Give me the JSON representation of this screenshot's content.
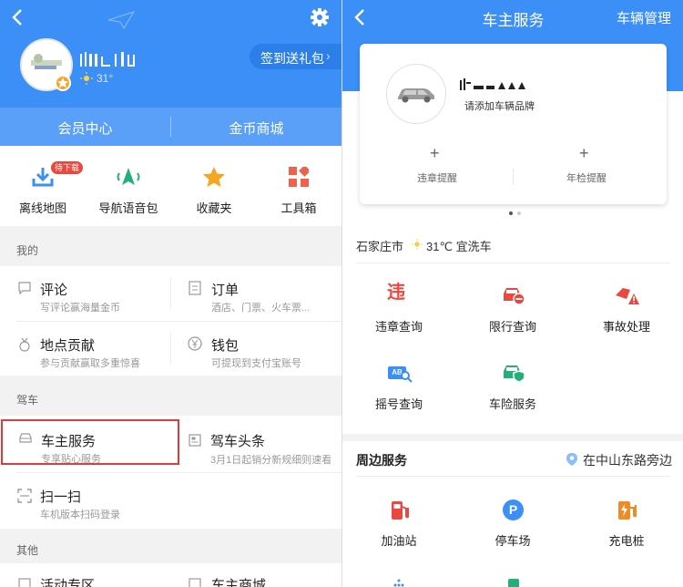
{
  "left": {
    "profile": {
      "temperature": "31°",
      "signin_label": "签到送礼包"
    },
    "member_tabs": [
      "会员中心",
      "金币商城"
    ],
    "quick": [
      {
        "label": "离线地图",
        "badge": "待下载"
      },
      {
        "label": "导航语音包"
      },
      {
        "label": "收藏夹"
      },
      {
        "label": "工具箱"
      }
    ],
    "mine_title": "我的",
    "mine_items": [
      {
        "title": "评论",
        "sub": "写评论赢海量金币"
      },
      {
        "title": "订单",
        "sub": "酒店、门票、火车票..."
      },
      {
        "title": "地点贡献",
        "sub": "参与贡献赢取多重惊喜"
      },
      {
        "title": "钱包",
        "sub": "可提现到支付宝账号"
      }
    ],
    "drive_title": "驾车",
    "drive_items": [
      {
        "title": "车主服务",
        "sub": "专享贴心服务"
      },
      {
        "title": "驾车头条",
        "sub": "3月1日起销分新规细则速看"
      },
      {
        "title": "扫一扫",
        "sub": "车机版本扫码登录"
      }
    ],
    "other_title": "其他",
    "other_items": [
      {
        "title": "活动专区"
      },
      {
        "title": "车主商城"
      }
    ]
  },
  "right": {
    "header": {
      "title": "车主服务",
      "action": "车辆管理"
    },
    "card": {
      "add_brand": "请添加车辆品牌",
      "violation_reminder": "违章提醒",
      "inspection_reminder": "年检提醒",
      "plus": "+"
    },
    "weather": {
      "city": "石家庄市",
      "temp": "31℃ 宜洗车"
    },
    "services": [
      {
        "label": "违章查询",
        "glyph": "违"
      },
      {
        "label": "限行查询"
      },
      {
        "label": "事故处理"
      },
      {
        "label": "摇号查询",
        "glyph": "AB"
      },
      {
        "label": "车险服务"
      }
    ],
    "nearby": {
      "title": "周边服务",
      "location": "在中山东路旁边",
      "items": [
        {
          "label": "加油站"
        },
        {
          "label": "停车场",
          "glyph": "P"
        },
        {
          "label": "充电桩"
        }
      ]
    }
  },
  "colors": {
    "blue": "#3b8ff7",
    "red": "#e8483f",
    "green": "#21b07a",
    "orange": "#f5a623",
    "highlight": "#e03a3a"
  }
}
